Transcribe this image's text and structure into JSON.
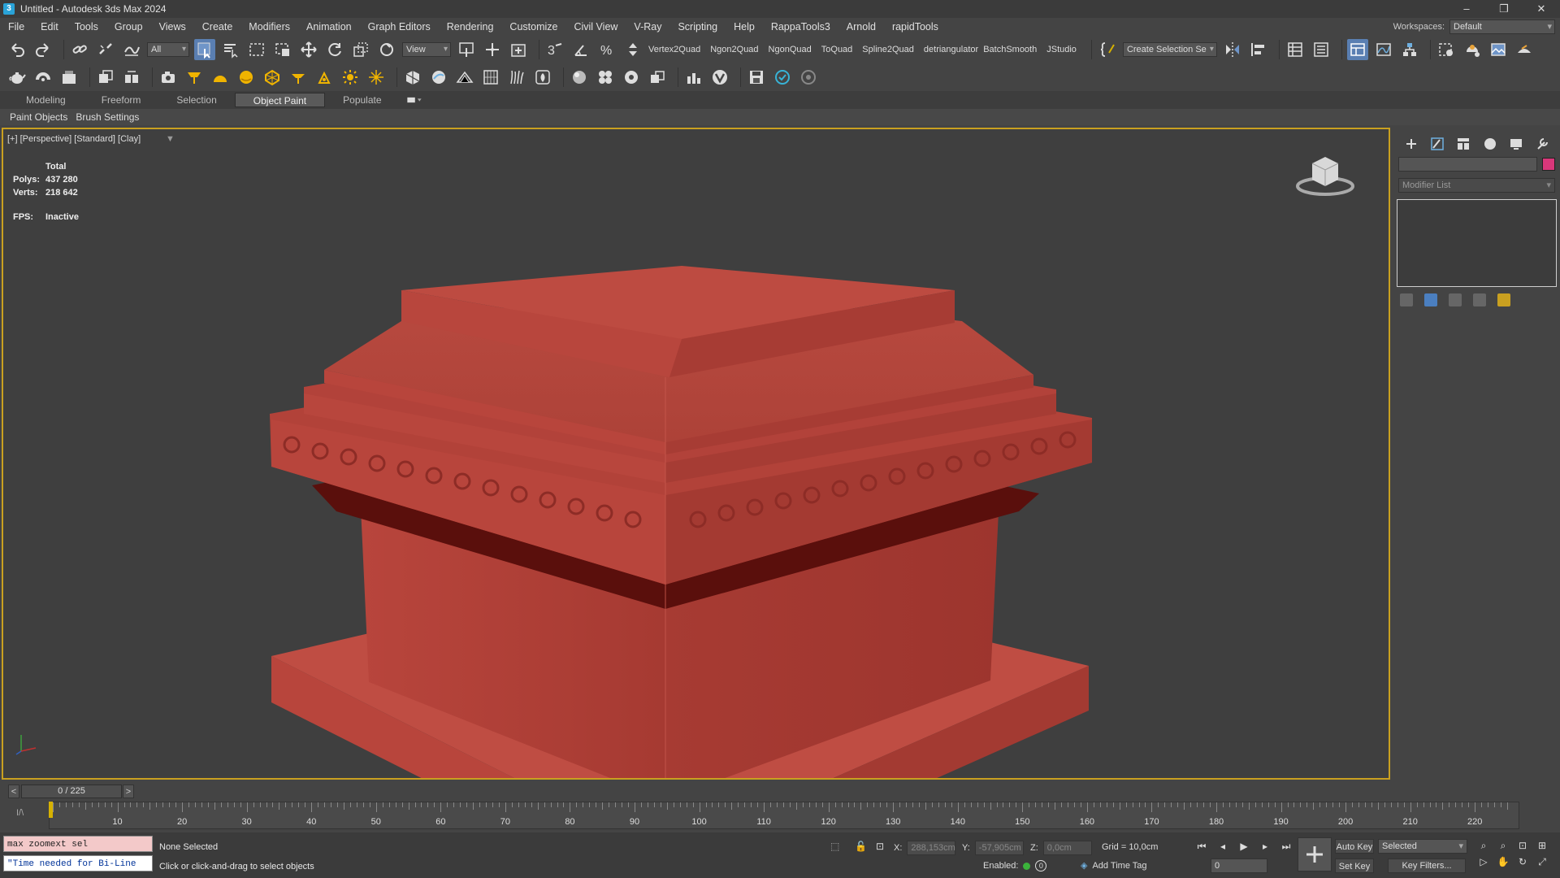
{
  "window": {
    "title": "Untitled - Autodesk 3ds Max 2024",
    "app_icon": "3"
  },
  "window_controls": {
    "minimize": "–",
    "restore": "❐",
    "close": "✕"
  },
  "menu": {
    "items": [
      "File",
      "Edit",
      "Tools",
      "Group",
      "Views",
      "Create",
      "Modifiers",
      "Animation",
      "Graph Editors",
      "Rendering",
      "Customize",
      "Civil View",
      "V-Ray",
      "Scripting",
      "Help",
      "RappaTools3",
      "Arnold",
      "rapidTools"
    ],
    "workspace_label": "Workspaces:",
    "workspace_value": "Default"
  },
  "toolbar": {
    "selection_filter": "All",
    "ref_coord": "View",
    "script_buttons": [
      "Vertex2Quad",
      "Ngon2Quad",
      "NgonQuad",
      "ToQuad",
      "Spline2Quad",
      "detriangulator",
      "BatchSmooth",
      "JStudio"
    ],
    "named_selection": "Create Selection Se"
  },
  "ribbon": {
    "tabs": [
      "Modeling",
      "Freeform",
      "Selection",
      "Object Paint",
      "Populate"
    ],
    "active_tab": "Object Paint",
    "sub_items": [
      "Paint Objects",
      "Brush Settings"
    ]
  },
  "viewport": {
    "label": "[+] [Perspective] [Standard] [Clay]",
    "stats_title": "Total",
    "polys_label": "Polys:",
    "polys_value": "437 280",
    "verts_label": "Verts:",
    "verts_value": "218 642",
    "fps_label": "FPS:",
    "fps_value": "Inactive",
    "model_color": "#b8453c",
    "border_color": "#c9a020"
  },
  "command_panel": {
    "modifier_list": "Modifier List",
    "object_color": "#d9377a"
  },
  "timeline": {
    "frame_display": "0 / 225",
    "prev": "<",
    "next": ">",
    "ticks": [
      "10",
      "20",
      "30",
      "40",
      "50",
      "60",
      "70",
      "80",
      "90",
      "100",
      "110",
      "120",
      "130",
      "140",
      "150",
      "160",
      "170",
      "180",
      "190",
      "200",
      "210",
      "220"
    ],
    "total_frames": 225
  },
  "status": {
    "script_input": "max zoomext sel",
    "script_output": "\"Time needed for Bi-Line",
    "selection_status": "None Selected",
    "prompt": "Click or click-and-drag to select objects",
    "x_label": "X:",
    "x_value": "288,153cm",
    "y_label": "Y:",
    "y_value": "-57,905cm",
    "z_label": "Z:",
    "z_value": "0,0cm",
    "grid": "Grid = 10,0cm",
    "enabled_label": "Enabled:",
    "enabled_zero": "0",
    "add_time_tag": "Add Time Tag",
    "auto_key": "Auto Key",
    "set_key": "Set Key",
    "key_mode": "Selected",
    "key_filters": "Key Filters...",
    "current_frame": "0"
  }
}
